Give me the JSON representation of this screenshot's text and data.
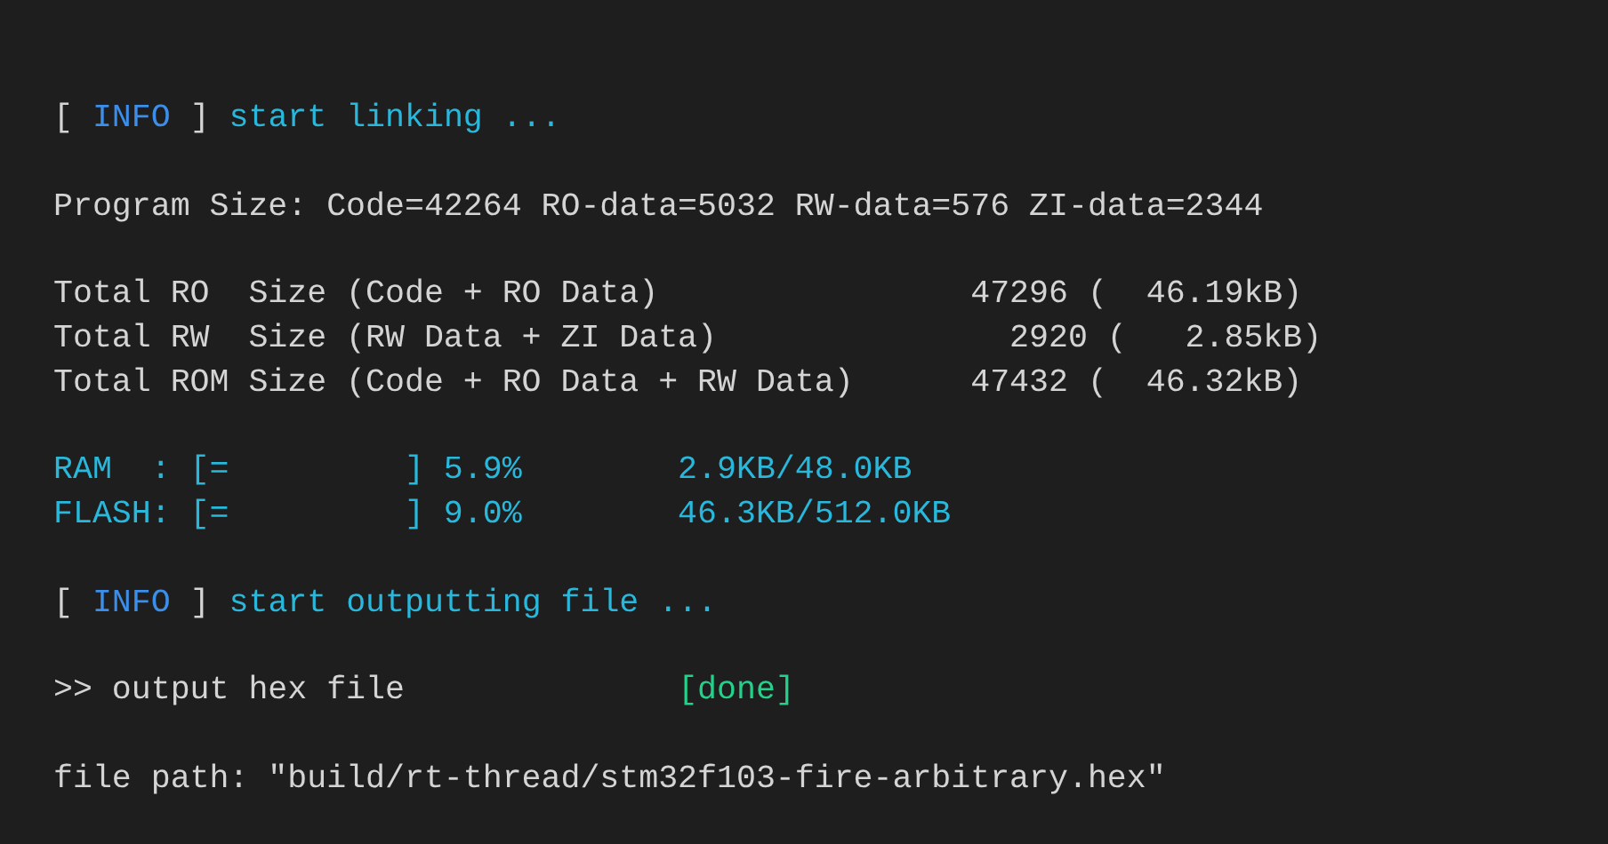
{
  "terminal": {
    "lines": [
      {
        "kind": "text",
        "segments": [
          {
            "kind": "bracket",
            "text": "[ "
          },
          {
            "kind": "tag",
            "text": "INFO"
          },
          {
            "kind": "bracket",
            "text": " ] "
          },
          {
            "kind": "message",
            "text": "start linking ..."
          }
        ]
      },
      {
        "kind": "blank"
      },
      {
        "kind": "text",
        "segments": [
          {
            "kind": "plain",
            "text": "Program Size: Code=42264 RO-data=5032 RW-data=576 ZI-data=2344"
          }
        ]
      },
      {
        "kind": "blank"
      },
      {
        "kind": "text",
        "segments": [
          {
            "kind": "plain",
            "text": "Total RO  Size (Code + RO Data)                47296 (  46.19kB)"
          }
        ]
      },
      {
        "kind": "text",
        "segments": [
          {
            "kind": "plain",
            "text": "Total RW  Size (RW Data + ZI Data)               2920 (   2.85kB)"
          }
        ]
      },
      {
        "kind": "text",
        "segments": [
          {
            "kind": "plain",
            "text": "Total ROM Size (Code + RO Data + RW Data)      47432 (  46.32kB)"
          }
        ]
      },
      {
        "kind": "blank"
      },
      {
        "kind": "text",
        "segments": [
          {
            "kind": "message",
            "text": "RAM  : [=         ] 5.9%        2.9KB/48.0KB"
          }
        ]
      },
      {
        "kind": "text",
        "segments": [
          {
            "kind": "message",
            "text": "FLASH: [=         ] 9.0%        46.3KB/512.0KB"
          }
        ]
      },
      {
        "kind": "blank"
      },
      {
        "kind": "text",
        "segments": [
          {
            "kind": "bracket",
            "text": "[ "
          },
          {
            "kind": "tag",
            "text": "INFO"
          },
          {
            "kind": "bracket",
            "text": " ] "
          },
          {
            "kind": "message",
            "text": "start outputting file ..."
          }
        ]
      },
      {
        "kind": "blank"
      },
      {
        "kind": "text",
        "segments": [
          {
            "kind": "plain",
            "text": ">> output hex file              "
          },
          {
            "kind": "done",
            "text": "[done]"
          }
        ]
      },
      {
        "kind": "blank"
      },
      {
        "kind": "text",
        "segments": [
          {
            "kind": "plain",
            "text": "file path: \"build/rt-thread/stm32f103-fire-arbitrary.hex\""
          }
        ]
      }
    ]
  }
}
